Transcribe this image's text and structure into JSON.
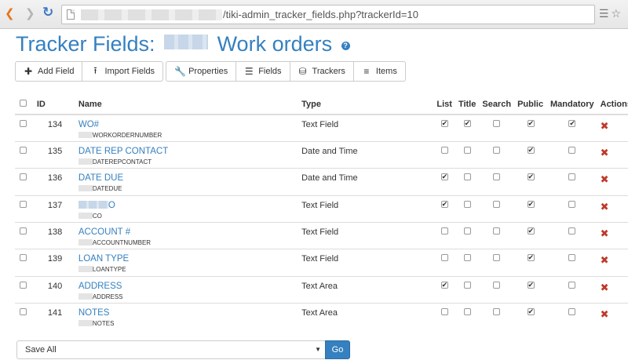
{
  "browser": {
    "url_visible": "/tiki-admin_tracker_fields.php?trackerId=10"
  },
  "page": {
    "title_prefix": "Tracker Fields:",
    "title_suffix": "Work orders",
    "help_icon": "question-circle-icon"
  },
  "toolbar": {
    "add_field": "Add Field",
    "import_fields": "Import Fields",
    "properties": "Properties",
    "fields": "Fields",
    "trackers": "Trackers",
    "items": "Items"
  },
  "table": {
    "headers": {
      "id": "ID",
      "name": "Name",
      "type": "Type",
      "list": "List",
      "title": "Title",
      "search": "Search",
      "public": "Public",
      "mandatory": "Mandatory",
      "actions": "Actions"
    },
    "rows": [
      {
        "id": "134",
        "name": "WO#",
        "perm": "WORKORDERNUMBER",
        "type": "Text Field",
        "list": true,
        "title": true,
        "search": false,
        "public": true,
        "mandatory": true
      },
      {
        "id": "135",
        "name": "DATE REP CONTACT",
        "perm": "DATEREPCONTACT",
        "type": "Date and Time",
        "list": false,
        "title": false,
        "search": false,
        "public": true,
        "mandatory": false
      },
      {
        "id": "136",
        "name": "DATE DUE",
        "perm": "DATEDUE",
        "type": "Date and Time",
        "list": true,
        "title": false,
        "search": false,
        "public": true,
        "mandatory": false
      },
      {
        "id": "137",
        "name": "O",
        "perm": "CO",
        "type": "Text Field",
        "list": true,
        "title": false,
        "search": false,
        "public": true,
        "mandatory": false
      },
      {
        "id": "138",
        "name": "ACCOUNT #",
        "perm": "ACCOUNTNUMBER",
        "type": "Text Field",
        "list": false,
        "title": false,
        "search": false,
        "public": true,
        "mandatory": false
      },
      {
        "id": "139",
        "name": "LOAN TYPE",
        "perm": "LOANTYPE",
        "type": "Text Field",
        "list": false,
        "title": false,
        "search": false,
        "public": true,
        "mandatory": false
      },
      {
        "id": "140",
        "name": "ADDRESS",
        "perm": "ADDRESS",
        "type": "Text Area",
        "list": true,
        "title": false,
        "search": false,
        "public": true,
        "mandatory": false
      },
      {
        "id": "141",
        "name": "NOTES",
        "perm": "NOTES",
        "type": "Text Area",
        "list": false,
        "title": false,
        "search": false,
        "public": true,
        "mandatory": false
      }
    ]
  },
  "bottom": {
    "select_value": "Save All",
    "go_label": "Go"
  }
}
